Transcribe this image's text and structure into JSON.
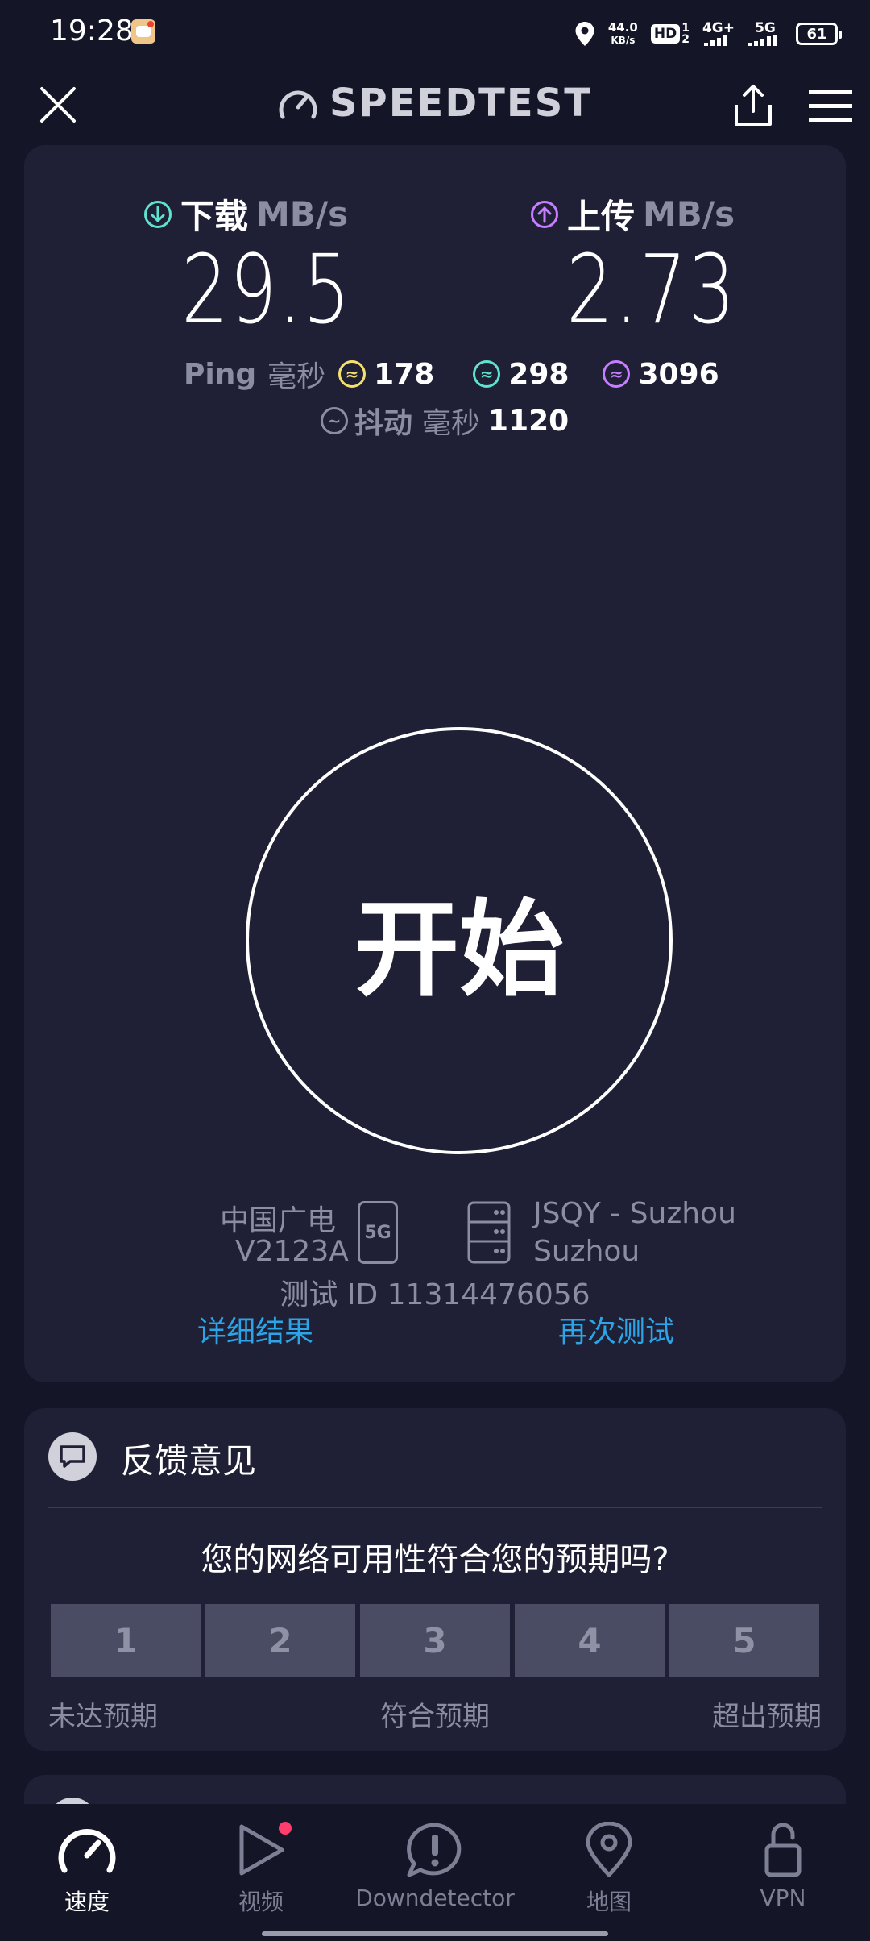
{
  "status_bar": {
    "time": "19:28",
    "net_speed_value": "44.0",
    "net_speed_unit": "KB/s",
    "hd": "HD",
    "sim_top": "1",
    "sim_bottom": "2",
    "net1": "4G+",
    "net2": "5G",
    "battery": "61"
  },
  "header": {
    "brand": "SPEEDTEST"
  },
  "results": {
    "download_label": "下载",
    "download_unit": "MB/s",
    "download_value": "29.5",
    "upload_label": "上传",
    "upload_unit": "MB/s",
    "upload_value": "2.73",
    "ping_label": "Ping",
    "ping_unit": "毫秒",
    "ping_idle": "178",
    "ping_download": "298",
    "ping_upload": "3096",
    "jitter_label": "抖动",
    "jitter_unit": "毫秒",
    "jitter_value": "1120"
  },
  "start_button": "开始",
  "connection": {
    "carrier": "中国广电",
    "device": "V2123A",
    "net_badge": "5G",
    "server_name": "JSQY - Suzhou",
    "server_city": "Suzhou",
    "test_id": "测试 ID 11314476056",
    "details_link": "详细结果",
    "retest_link": "再次测试"
  },
  "feedback": {
    "title": "反馈意见",
    "question": "您的网络可用性符合您的预期吗?",
    "ratings": [
      "1",
      "2",
      "3",
      "4",
      "5"
    ],
    "low_label": "未达预期",
    "mid_label": "符合预期",
    "high_label": "超出预期"
  },
  "nav": [
    {
      "label": "速度",
      "active": true
    },
    {
      "label": "视频",
      "active": false
    },
    {
      "label": "Downdetector",
      "active": false
    },
    {
      "label": "地图",
      "active": false
    },
    {
      "label": "VPN",
      "active": false
    }
  ],
  "colors": {
    "background": "#141526",
    "card": "#1f2035",
    "accent_link": "#2ba5e8",
    "download_icon": "#5fe3d0",
    "upload_icon": "#c77dff",
    "ping_idle_icon": "#f4e06d",
    "ping_download_icon": "#5fe3d0",
    "ping_upload_icon": "#c77dff",
    "notification_dot": "#ff3d6e"
  }
}
